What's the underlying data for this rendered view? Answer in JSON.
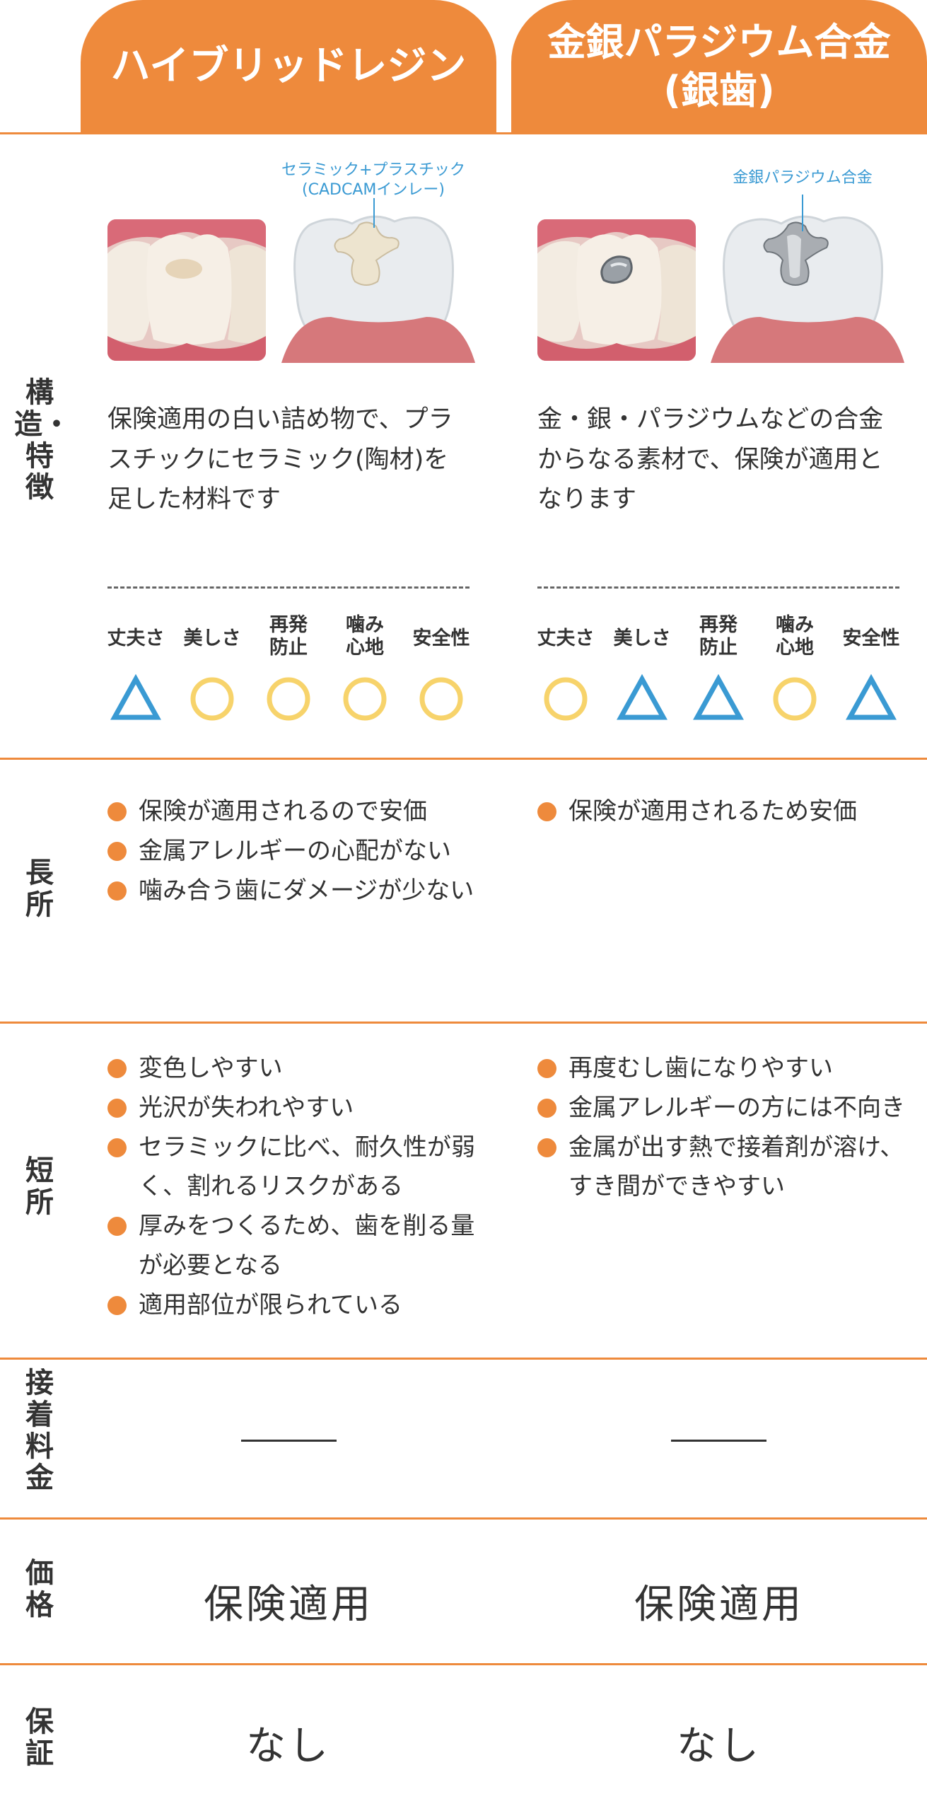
{
  "header": {
    "left": "ハイブリッドレジン",
    "right_line1": "金銀パラジウム合金",
    "right_line2": "(銀歯)"
  },
  "row_labels": {
    "structure": "構造・特徴",
    "merits": "長所",
    "demerits": "短所",
    "bonding_fee": "接着料金",
    "price": "価格",
    "warranty": "保証"
  },
  "callouts": {
    "left_line1": "セラミック+プラスチック",
    "left_line2": "(CADCAMインレー)",
    "right": "金銀パラジウム合金"
  },
  "descriptions": {
    "left": [
      "保険適用の白い詰め物で、プラ",
      "スチックにセラミック(陶材)を",
      "足した材料です"
    ],
    "right": [
      "金・銀・パラジウムなどの合金",
      "からなる素材で、保険が適用と",
      "なります"
    ]
  },
  "ratings": {
    "labels": [
      {
        "line1": "丈夫さ",
        "line2": ""
      },
      {
        "line1": "美しさ",
        "line2": ""
      },
      {
        "line1": "再発",
        "line2": "防止"
      },
      {
        "line1": "噛み",
        "line2": "心地"
      },
      {
        "line1": "安全性",
        "line2": ""
      }
    ],
    "left": [
      "triangle",
      "circle",
      "circle",
      "circle",
      "circle"
    ],
    "right": [
      "circle",
      "triangle",
      "triangle",
      "circle",
      "triangle"
    ]
  },
  "merits": {
    "left": [
      "保険が適用されるので安価",
      "金属アレルギーの心配がない",
      "噛み合う歯にダメージが少ない"
    ],
    "right": [
      "保険が適用されるため安価"
    ]
  },
  "demerits": {
    "left": [
      "変色しやすい",
      "光沢が失われやすい",
      "セラミックに比べ、耐久性が弱く、割れるリスクがある",
      "厚みをつくるため、歯を削る量が必要となる",
      "適用部位が限られている"
    ],
    "right": [
      "再度むし歯になりやすい",
      "金属アレルギーの方には不向き",
      "金属が出す熱で接着剤が溶け、すき間ができやすい"
    ]
  },
  "price": {
    "left": "保険適用",
    "right": "保険適用"
  },
  "warranty": {
    "left": "なし",
    "right": "なし"
  },
  "colors": {
    "accent": "#EE8A3C",
    "triangle": "#3A9AD3",
    "circle": "#F7D36B",
    "callout": "#3A9AD3"
  }
}
